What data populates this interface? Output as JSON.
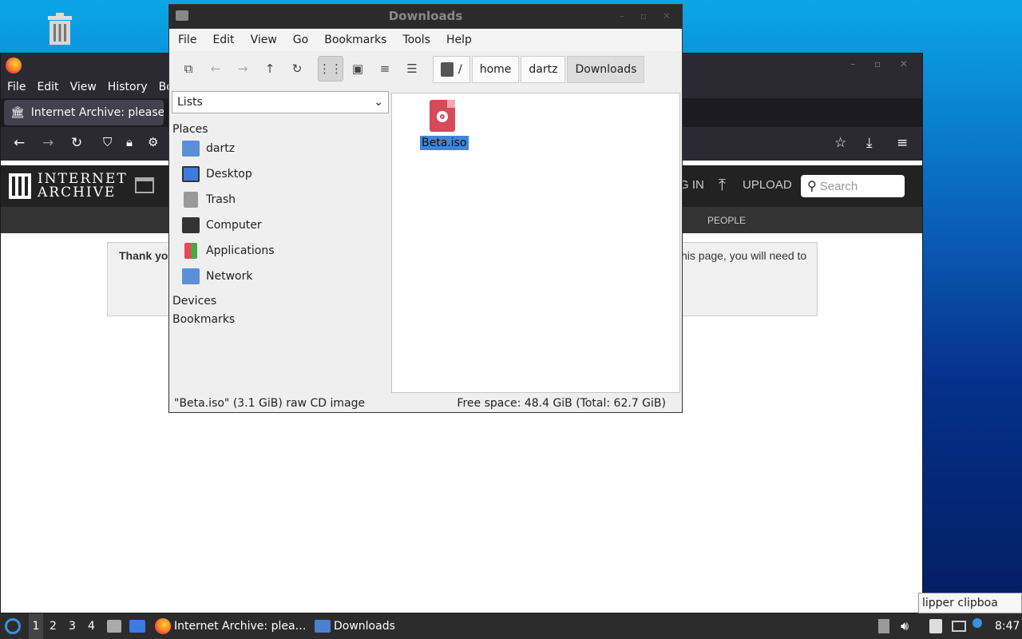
{
  "firefox": {
    "menu": [
      "File",
      "Edit",
      "View",
      "History",
      "Boo"
    ],
    "tab_title": "Internet Archive: please",
    "ia": {
      "logo_line1": "INTERNET",
      "logo_line2": "ARCHIVE",
      "sign_in": "G IN",
      "upload": "UPLOAD",
      "search_placeholder": "Search",
      "people": "PEOPLE",
      "notice_left": "Thank you",
      "notice_right": "his page, you will need to"
    }
  },
  "fm": {
    "title": "Downloads",
    "menu": [
      "File",
      "Edit",
      "View",
      "Go",
      "Bookmarks",
      "Tools",
      "Help"
    ],
    "breadcrumb": [
      "/",
      "home",
      "dartz",
      "Downloads"
    ],
    "sidebar_mode": "Lists",
    "places_heading": "Places",
    "places": [
      "dartz",
      "Desktop",
      "Trash",
      "Computer",
      "Applications",
      "Network"
    ],
    "devices_heading": "Devices",
    "bookmarks_heading": "Bookmarks",
    "file_name": "Beta.iso",
    "status_left": "\"Beta.iso\" (3.1 GiB) raw CD image",
    "status_right": "Free space: 48.4 GiB (Total: 62.7 GiB)"
  },
  "taskbar": {
    "workspaces": [
      "1",
      "2",
      "3",
      "4"
    ],
    "task_firefox": "Internet Archive: plea…",
    "task_downloads": "Downloads",
    "clock": "8:47",
    "tooltip": "lipper clipboa"
  },
  "colors": {
    "selection": "#3f86d9",
    "iso_icon": "#d64a5a",
    "panel": "#2c2c2c"
  }
}
